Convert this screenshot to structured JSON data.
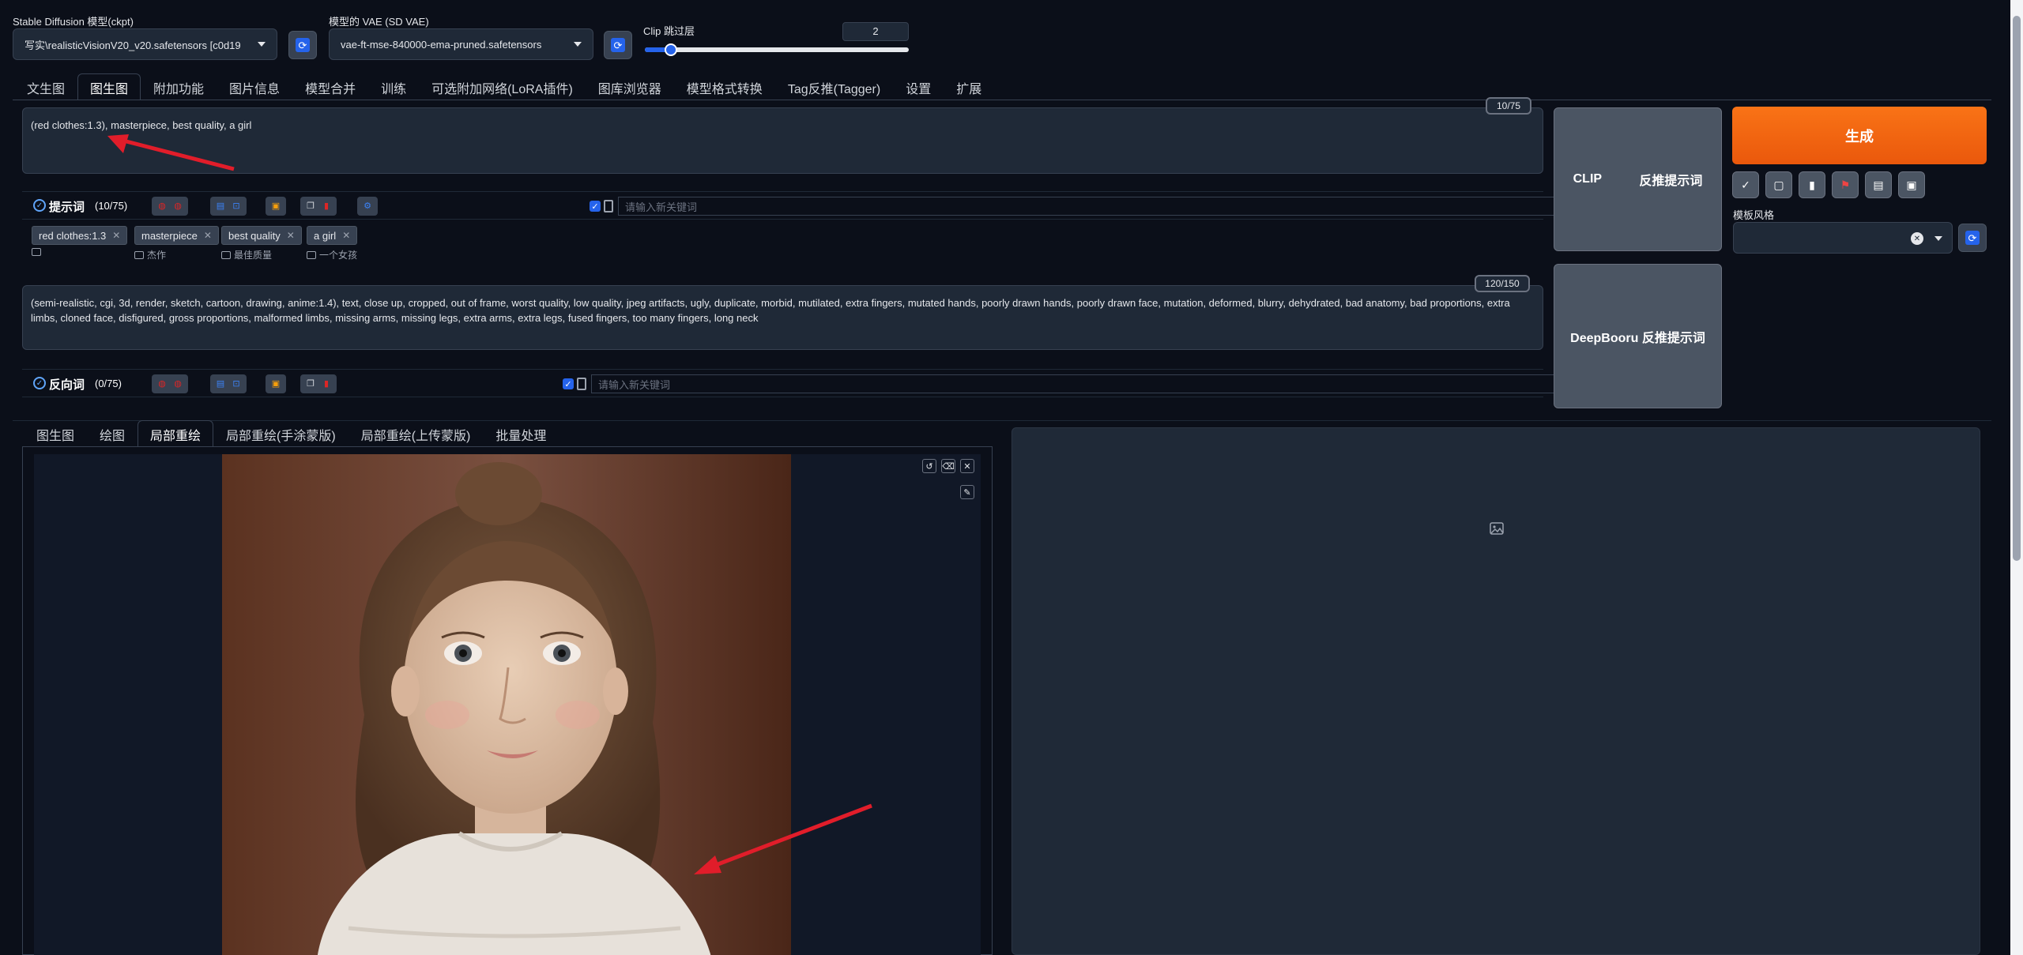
{
  "header": {
    "ckpt_label": "Stable Diffusion 模型(ckpt)",
    "ckpt_value": "写实\\realisticVisionV20_v20.safetensors [c0d19",
    "vae_label": "模型的 VAE (SD VAE)",
    "vae_value": "vae-ft-mse-840000-ema-pruned.safetensors",
    "clip_label": "Clip 跳过层",
    "clip_value": "2",
    "clip_slider_fraction": 0.1
  },
  "tabs": [
    "文生图",
    "图生图",
    "附加功能",
    "图片信息",
    "模型合并",
    "训练",
    "可选附加网络(LoRA插件)",
    "图库浏览器",
    "模型格式转换",
    "Tag反推(Tagger)",
    "设置",
    "扩展"
  ],
  "active_tab": "图生图",
  "prompt": {
    "text": "(red clothes:1.3), masterpiece, best quality, a girl",
    "counter": "10/75",
    "section_label": "提示词",
    "section_count": "(10/75)",
    "keyword_placeholder": "请输入新关键词",
    "chips": [
      {
        "label": "red clothes:1.3",
        "sub": ""
      },
      {
        "label": "masterpiece",
        "sub": "杰作"
      },
      {
        "label": "best quality",
        "sub": "最佳质量"
      },
      {
        "label": "a girl",
        "sub": "一个女孩"
      }
    ]
  },
  "negative": {
    "text": "(semi-realistic, cgi, 3d, render, sketch, cartoon, drawing, anime:1.4), text, close up, cropped, out of frame, worst quality, low quality, jpeg artifacts, ugly, duplicate, morbid, mutilated, extra fingers, mutated hands, poorly drawn hands, poorly drawn face, mutation, deformed, blurry, dehydrated, bad anatomy, bad proportions, extra limbs, cloned face, disfigured, gross proportions, malformed limbs, missing arms, missing legs, extra arms, extra legs, fused fingers, too many fingers, long neck",
    "counter": "120/150",
    "section_label": "反向词",
    "section_count": "(0/75)",
    "keyword_placeholder": "请输入新关键词"
  },
  "buttons": {
    "clip": "CLIP",
    "clip_interrogate": "反推提示词",
    "deepbooru": "DeepBooru 反推提示词",
    "generate": "生成",
    "styles_label": "模板风格"
  },
  "sub_tabs": [
    "图生图",
    "绘图",
    "局部重绘",
    "局部重绘(手涂蒙版)",
    "局部重绘(上传蒙版)",
    "批量处理"
  ],
  "active_sub_tab": "局部重绘",
  "colors": {
    "accent": "#f97316",
    "background": "#0b0f19",
    "panel": "#1f2937",
    "arrow": "#e11d2a"
  },
  "icons": {
    "refresh": "refresh-icon",
    "image_placeholder": "image-icon",
    "undo": "undo-icon",
    "clear": "eraser-icon",
    "close": "close-icon",
    "brush": "brush-icon"
  }
}
